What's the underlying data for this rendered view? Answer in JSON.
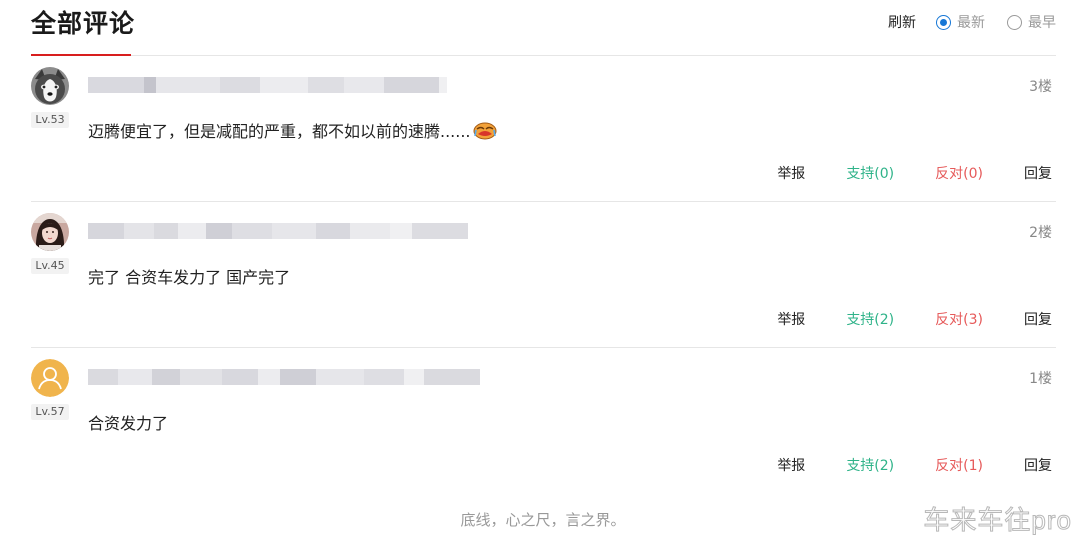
{
  "header": {
    "title": "全部评论",
    "refresh_label": "刷新",
    "sort_options": [
      {
        "label": "最新",
        "selected": true
      },
      {
        "label": "最早",
        "selected": false
      }
    ]
  },
  "comments": [
    {
      "level": "Lv.53",
      "floor": "3楼",
      "content": "迈腾便宜了，但是减配的严重，都不如以前的速腾......",
      "emoji": "crying-face-icon",
      "actions": {
        "report": "举报",
        "support": "支持(0)",
        "oppose": "反对(0)",
        "reply": "回复"
      },
      "avatar": "husky-dog-avatar"
    },
    {
      "level": "Lv.45",
      "floor": "2楼",
      "content": "完了 合资车发力了 国产完了",
      "actions": {
        "report": "举报",
        "support": "支持(2)",
        "oppose": "反对(3)",
        "reply": "回复"
      },
      "avatar": "girl-photo-avatar"
    },
    {
      "level": "Lv.57",
      "floor": "1楼",
      "content": "合资发力了",
      "actions": {
        "report": "举报",
        "support": "支持(2)",
        "oppose": "反对(1)",
        "reply": "回复"
      },
      "avatar": "default-user-avatar"
    }
  ],
  "footer": {
    "motto": "底线，心之尺，言之界。"
  },
  "watermark": "车来车往pro",
  "colors": {
    "accent_red": "#d81e1e",
    "radio_blue": "#1677d6",
    "support_green": "#2fb389",
    "oppose_red": "#e65a5a",
    "default_avatar": "#f0b44c"
  }
}
